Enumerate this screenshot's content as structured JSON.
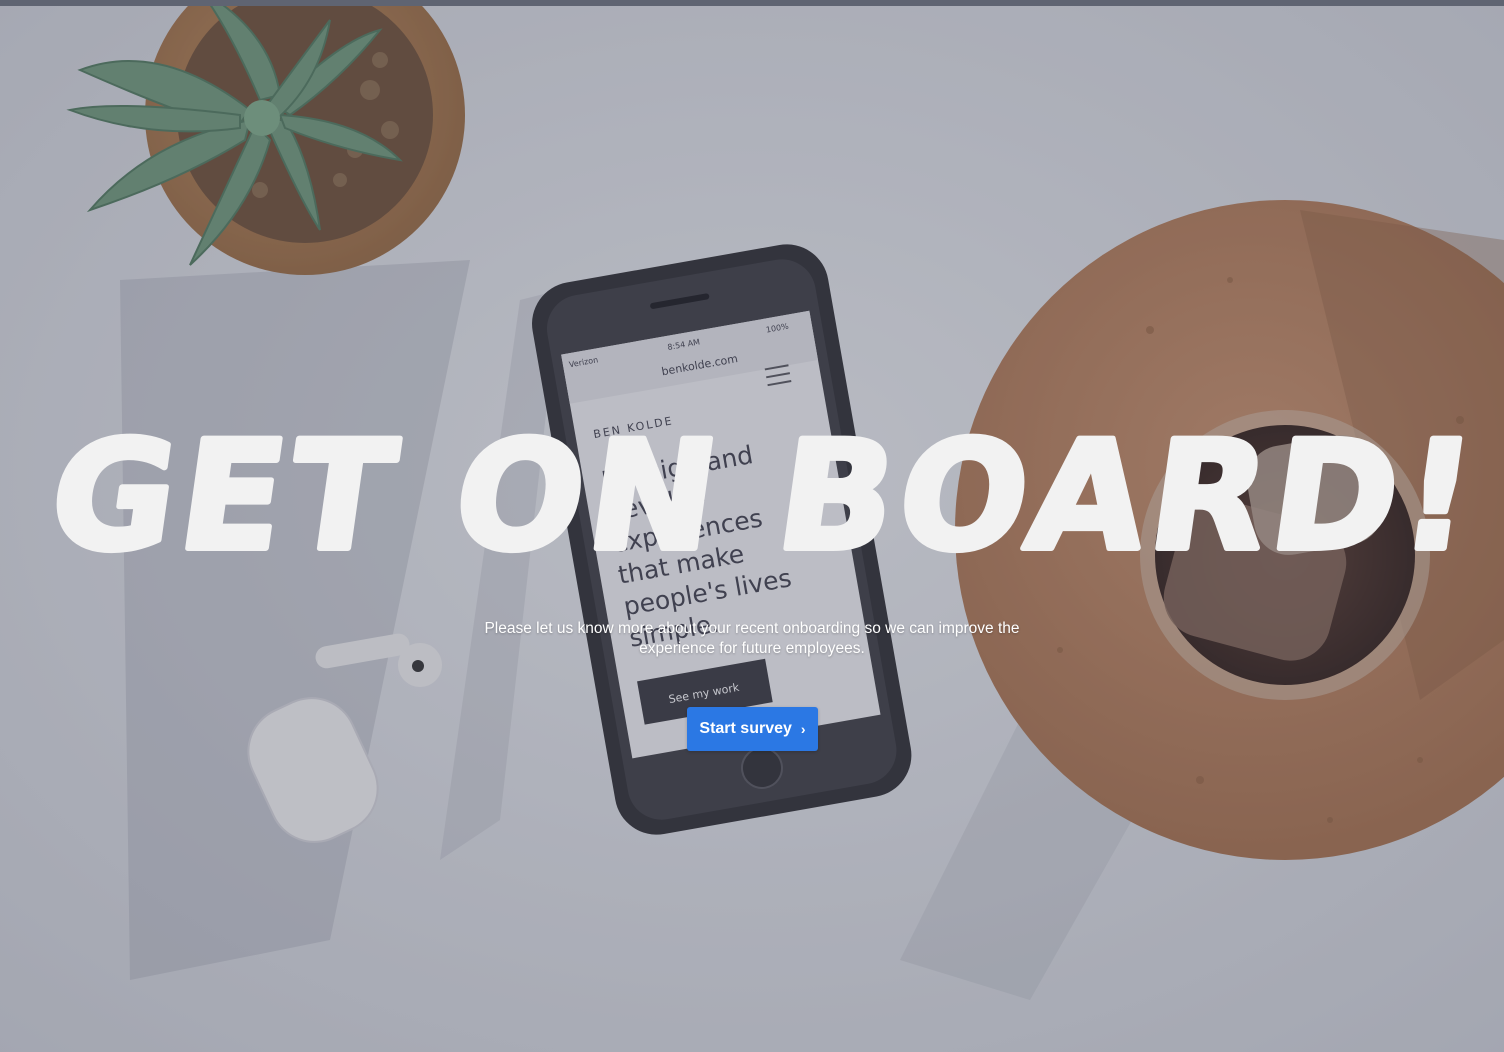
{
  "hero": {
    "title": "Get on board!",
    "subtitle": "Please let us know more about your recent onboarding so we can improve the experience for future employees."
  },
  "cta": {
    "label": "Start survey",
    "icon": "chevron-right-icon",
    "color": "#2b78e4"
  },
  "background_photo": {
    "phone_carrier": "Verizon",
    "phone_time": "8:54 AM",
    "phone_battery": "100%",
    "phone_url": "benkolde.com",
    "phone_brand": "BEN KOLDE",
    "phone_headline": "I design and develop experiences that make people's lives simple.",
    "phone_button": "See my work"
  },
  "colors": {
    "overlay": "#464a5c",
    "title_text": "#f2f2f2",
    "subtitle_text": "#ffffff"
  }
}
